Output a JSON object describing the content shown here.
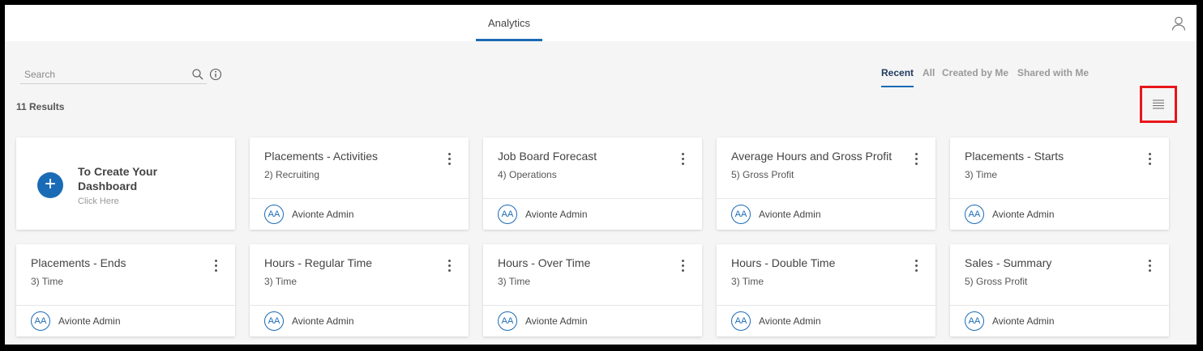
{
  "header": {
    "tab_label": "Analytics"
  },
  "search": {
    "placeholder": "Search"
  },
  "filters": [
    "Recent",
    "All",
    "Created by Me",
    "Shared with Me"
  ],
  "active_filter": "Recent",
  "results_label": "11 Results",
  "create_card": {
    "title": "To Create Your Dashboard",
    "subtitle": "Click Here"
  },
  "dashboards": [
    {
      "title": "Placements - Activities",
      "category": "2) Recruiting",
      "avatar": "AA",
      "owner": "Avionte Admin"
    },
    {
      "title": "Job Board Forecast",
      "category": "4) Operations",
      "avatar": "AA",
      "owner": "Avionte Admin"
    },
    {
      "title": "Average Hours and Gross Profit",
      "category": "5) Gross Profit",
      "avatar": "AA",
      "owner": "Avionte Admin"
    },
    {
      "title": "Placements - Starts",
      "category": "3) Time",
      "avatar": "AA",
      "owner": "Avionte Admin"
    },
    {
      "title": "Placements - Ends",
      "category": "3) Time",
      "avatar": "AA",
      "owner": "Avionte Admin"
    },
    {
      "title": "Hours - Regular Time",
      "category": "3) Time",
      "avatar": "AA",
      "owner": "Avionte Admin"
    },
    {
      "title": "Hours - Over Time",
      "category": "3) Time",
      "avatar": "AA",
      "owner": "Avionte Admin"
    },
    {
      "title": "Hours - Double Time",
      "category": "3) Time",
      "avatar": "AA",
      "owner": "Avionte Admin"
    },
    {
      "title": "Sales - Summary",
      "category": "5) Gross Profit",
      "avatar": "AA",
      "owner": "Avionte Admin"
    }
  ],
  "colors": {
    "accent": "#1a6bb5",
    "highlight_box": "#e8161b",
    "background": "#f5f5f5"
  },
  "icons": {
    "user": "user-icon",
    "search": "search-icon",
    "info": "info-icon",
    "list_view": "list-view-icon",
    "card_menu": "more-vertical-icon",
    "add": "plus-icon"
  }
}
